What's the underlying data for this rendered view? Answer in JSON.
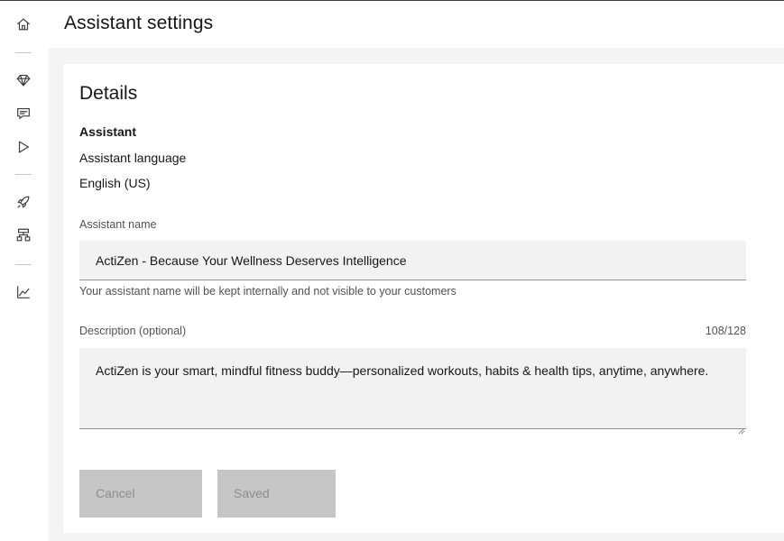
{
  "header": {
    "title": "Assistant settings"
  },
  "sidebar": {
    "icons": [
      "home-icon",
      "diamond-icon",
      "chat-icon",
      "play-icon",
      "rocket-icon",
      "hierarchy-icon",
      "analytics-icon"
    ]
  },
  "details": {
    "title": "Details",
    "assistant_heading": "Assistant",
    "language_label": "Assistant language",
    "language_value": "English (US)"
  },
  "name_field": {
    "label": "Assistant name",
    "value": "ActiZen - Because Your Wellness Deserves Intelligence",
    "helper": "Your assistant name will be kept internally and not visible to your customers"
  },
  "description_field": {
    "label": "Description (optional)",
    "counter": "108/128",
    "value": "ActiZen is your smart, mindful fitness buddy—personalized workouts, habits & health tips, anytime, anywhere."
  },
  "buttons": {
    "cancel": "Cancel",
    "saved": "Saved"
  },
  "colors": {
    "disabled_button": "#c6c6c6",
    "field_bg": "#f2f2f2",
    "content_bg": "#f4f4f4"
  }
}
